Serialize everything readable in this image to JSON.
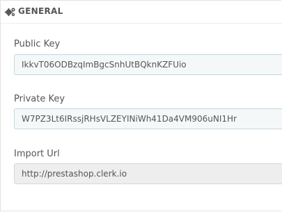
{
  "panel": {
    "title": "GENERAL",
    "icon": "cogs-icon"
  },
  "fields": {
    "public_key": {
      "label": "Public Key",
      "value": "IkkvT06ODBzqImBgcSnhUtBQknKZFUio"
    },
    "private_key": {
      "label": "Private Key",
      "value": "W7PZ3Lt6IRssjRHsVLZEYINiWh41Da4VM906uNI1Hr"
    },
    "import_url": {
      "label": "Import Url",
      "value": "http://prestashop.clerk.io"
    }
  }
}
